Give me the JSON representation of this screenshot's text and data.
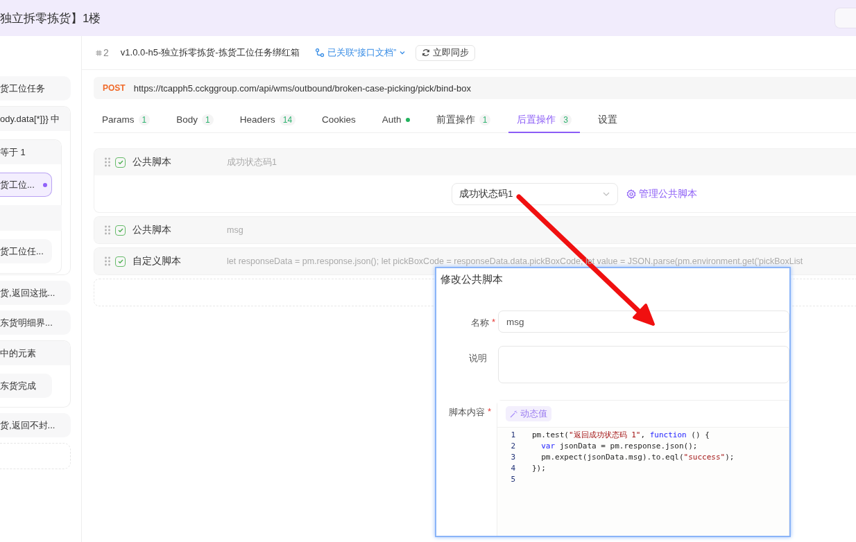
{
  "header": {
    "title": "独立拆零拣货】1楼"
  },
  "sidebar": {
    "items": [
      {
        "kind": "item",
        "label": "货工位任务",
        "selected": false
      },
      {
        "kind": "group",
        "label": "ody.data[*]}} 中",
        "children": [
          {
            "kind": "group",
            "label": "等于  1",
            "children": [
              {
                "kind": "item",
                "label": "货工位...",
                "selected": true
              },
              {
                "kind": "group",
                "children": [
                  {
                    "kind": "item",
                    "label": "货工位任...",
                    "selected": false
                  }
                ]
              }
            ]
          }
        ]
      },
      {
        "kind": "item",
        "label": "货,返回这批...",
        "selected": false
      },
      {
        "kind": "item",
        "label": "东货明细界...",
        "selected": false
      },
      {
        "kind": "group",
        "label": "中的元素",
        "children": [
          {
            "kind": "item",
            "label": "东货完成",
            "selected": false
          }
        ]
      },
      {
        "kind": "item",
        "label": "货,返回不封...",
        "selected": false
      },
      {
        "kind": "add"
      }
    ]
  },
  "request": {
    "number": "2",
    "name": "v1.0.0-h5-独立拆零拣货-拣货工位任务绑红箱",
    "doc_link": "已关联“接口文档”",
    "sync_button": "立即同步",
    "method": "POST",
    "url": "https://tcapph5.cckggroup.com/api/wms/outbound/broken-case-picking/pick/bind-box"
  },
  "tabs": [
    {
      "label": "Params",
      "count": "1",
      "selected": false
    },
    {
      "label": "Body",
      "count": "1",
      "selected": false
    },
    {
      "label": "Headers",
      "count": "14",
      "selected": false
    },
    {
      "label": "Cookies",
      "selected": false
    },
    {
      "label": "Auth",
      "dot": true,
      "selected": false
    },
    {
      "label": "前置操作",
      "count": "1",
      "selected": false
    },
    {
      "label": "后置操作",
      "count": "3",
      "selected": true
    },
    {
      "label": "设置",
      "selected": false
    }
  ],
  "scripts": [
    {
      "type": "公共脚本",
      "summary": "成功状态码1",
      "enabled": true,
      "expanded": true,
      "selected_script": "成功状态码1",
      "manage_link": "管理公共脚本"
    },
    {
      "type": "公共脚本",
      "summary": "msg",
      "enabled": true,
      "expanded": false
    },
    {
      "type": "自定义脚本",
      "summary": "let responseData = pm.response.json(); let pickBoxCode = responseData.data.pickBoxCode; let value = JSON.parse(pm.environment.get('pickBoxList",
      "enabled": true,
      "expanded": false
    }
  ],
  "dialog": {
    "title": "修改公共脚本",
    "fields": [
      {
        "kind": "input",
        "label": "名称",
        "required_mark": "*",
        "value": "msg"
      },
      {
        "kind": "textarea",
        "label": "说明"
      },
      {
        "kind": "code",
        "label": "脚本内容",
        "required_mark": "*",
        "button": "动态值",
        "lines": [
          {
            "number": "1",
            "tokens": [
              {
                "kind": "plain",
                "text": "pm.test("
              },
              {
                "kind": "string",
                "text": "\"返回成功状态码 1\""
              },
              {
                "kind": "plain",
                "text": ", "
              },
              {
                "kind": "keyword",
                "text": "function"
              },
              {
                "kind": "plain",
                "text": " () {"
              }
            ]
          },
          {
            "number": "2",
            "tokens": [
              {
                "kind": "keyword",
                "text": "  var"
              },
              {
                "kind": "plain",
                "text": " jsonData = pm.response.json();"
              }
            ]
          },
          {
            "number": "3",
            "tokens": [
              {
                "kind": "plain",
                "text": "  pm.expect(jsonData.msg).to.eql("
              },
              {
                "kind": "string",
                "text": "\"success\""
              },
              {
                "kind": "plain",
                "text": ");"
              }
            ]
          },
          {
            "number": "4",
            "tokens": [
              {
                "kind": "plain",
                "text": "});"
              }
            ]
          },
          {
            "number": "5"
          }
        ]
      }
    ]
  }
}
